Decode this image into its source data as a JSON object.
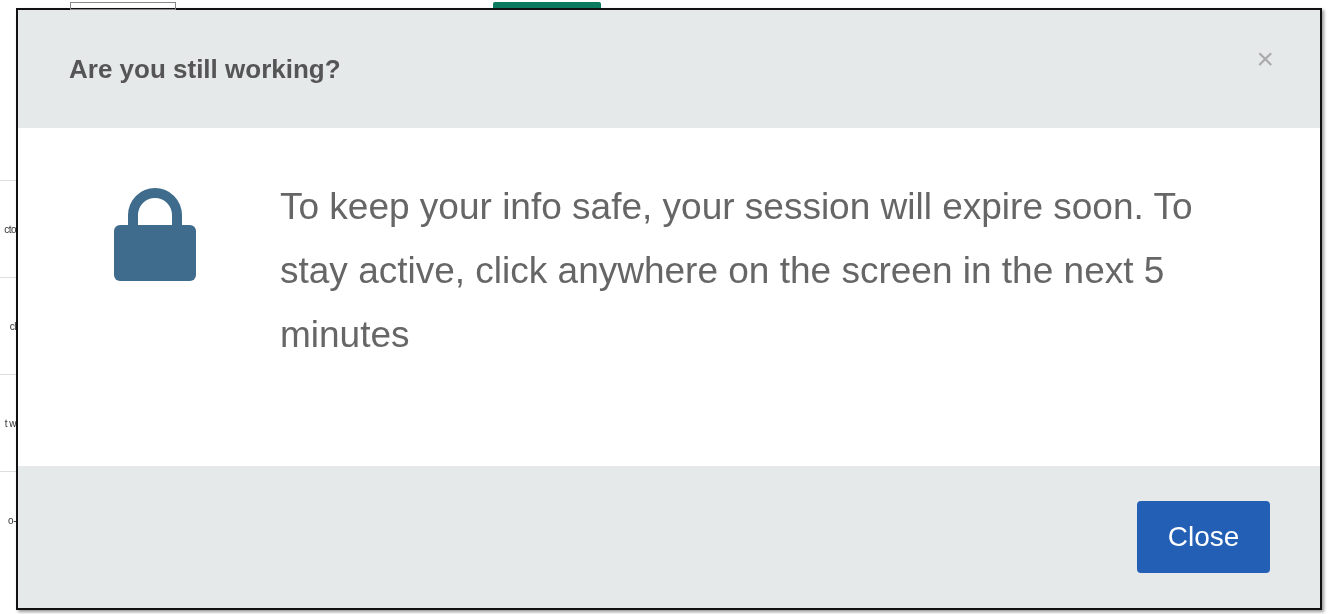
{
  "background": {
    "row_fragments": [
      "cto",
      "cl",
      "t w",
      "o-"
    ]
  },
  "dialog": {
    "title": "Are you still working?",
    "close_icon": "×",
    "message": "To keep your info safe, your session will expire soon. To stay active, click anywhere on the screen in the next 5 minutes",
    "buttons": [
      {
        "label": "Close",
        "kind": "primary"
      }
    ]
  }
}
